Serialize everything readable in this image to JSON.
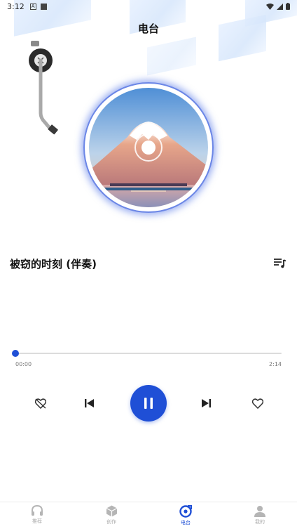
{
  "status_bar": {
    "time": "3:12",
    "icon_a": "A"
  },
  "header": {
    "title": "电台"
  },
  "player": {
    "song_title": "被窃的时刻 (伴奏)",
    "current_time": "00:00",
    "total_time": "2:14",
    "progress_fraction": 0.01
  },
  "bottom_nav": {
    "items": [
      {
        "label": "推荐",
        "icon": "headphones-icon",
        "active": false
      },
      {
        "label": "创作",
        "icon": "box-icon",
        "active": false
      },
      {
        "label": "电台",
        "icon": "radio-disc-icon",
        "active": true
      },
      {
        "label": "我的",
        "icon": "person-icon",
        "active": false
      }
    ]
  },
  "colors": {
    "accent": "#1f4fd6",
    "inactive": "#b5b5b5"
  }
}
